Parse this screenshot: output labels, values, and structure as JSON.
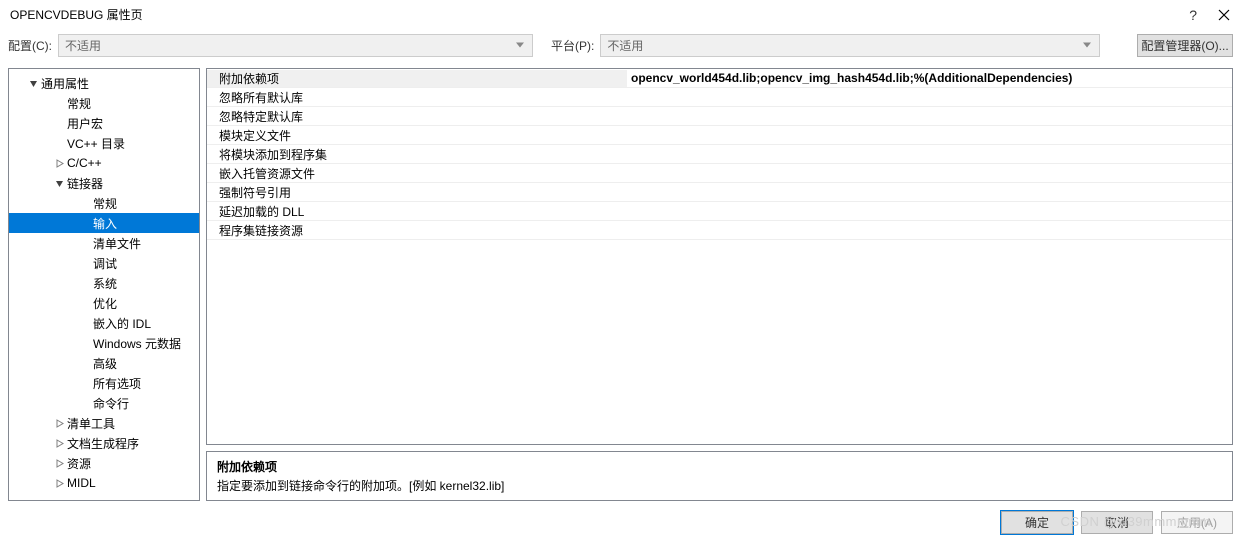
{
  "titlebar": {
    "title": "OPENCVDEBUG 属性页",
    "help_symbol": "?",
    "close_label": "关闭"
  },
  "toolbar": {
    "config_label": "配置(C):",
    "config_value": "不适用",
    "platform_label": "平台(P):",
    "platform_value": "不适用",
    "config_manager_label": "配置管理器(O)..."
  },
  "tree": {
    "items": [
      {
        "label": "通用属性",
        "indent": 18,
        "exp": "open"
      },
      {
        "label": "常规",
        "indent": 44,
        "exp": "none"
      },
      {
        "label": "用户宏",
        "indent": 44,
        "exp": "none"
      },
      {
        "label": "VC++ 目录",
        "indent": 44,
        "exp": "none"
      },
      {
        "label": "C/C++",
        "indent": 44,
        "exp": "closed"
      },
      {
        "label": "链接器",
        "indent": 44,
        "exp": "open"
      },
      {
        "label": "常规",
        "indent": 70,
        "exp": "none"
      },
      {
        "label": "输入",
        "indent": 70,
        "exp": "none",
        "selected": true
      },
      {
        "label": "清单文件",
        "indent": 70,
        "exp": "none"
      },
      {
        "label": "调试",
        "indent": 70,
        "exp": "none"
      },
      {
        "label": "系统",
        "indent": 70,
        "exp": "none"
      },
      {
        "label": "优化",
        "indent": 70,
        "exp": "none"
      },
      {
        "label": "嵌入的 IDL",
        "indent": 70,
        "exp": "none"
      },
      {
        "label": "Windows 元数据",
        "indent": 70,
        "exp": "none"
      },
      {
        "label": "高级",
        "indent": 70,
        "exp": "none"
      },
      {
        "label": "所有选项",
        "indent": 70,
        "exp": "none"
      },
      {
        "label": "命令行",
        "indent": 70,
        "exp": "none"
      },
      {
        "label": "清单工具",
        "indent": 44,
        "exp": "closed"
      },
      {
        "label": "文档生成程序",
        "indent": 44,
        "exp": "closed"
      },
      {
        "label": "资源",
        "indent": 44,
        "exp": "closed"
      },
      {
        "label": "MIDL",
        "indent": 44,
        "exp": "closed"
      }
    ]
  },
  "properties": {
    "rows": [
      {
        "label": "附加依赖项",
        "value": "opencv_world454d.lib;opencv_img_hash454d.lib;%(AdditionalDependencies)",
        "selected": true
      },
      {
        "label": "忽略所有默认库",
        "value": ""
      },
      {
        "label": "忽略特定默认库",
        "value": ""
      },
      {
        "label": "模块定义文件",
        "value": ""
      },
      {
        "label": "将模块添加到程序集",
        "value": ""
      },
      {
        "label": "嵌入托管资源文件",
        "value": ""
      },
      {
        "label": "强制符号引用",
        "value": ""
      },
      {
        "label": "延迟加载的 DLL",
        "value": ""
      },
      {
        "label": "程序集链接资源",
        "value": ""
      }
    ]
  },
  "description": {
    "title": "附加依赖项",
    "text": "指定要添加到链接命令行的附加项。[例如 kernel32.lib]"
  },
  "footer": {
    "ok": "确定",
    "cancel": "取消",
    "apply": "应用(A)"
  },
  "watermark": "CSDN @xl39mmmmmm"
}
